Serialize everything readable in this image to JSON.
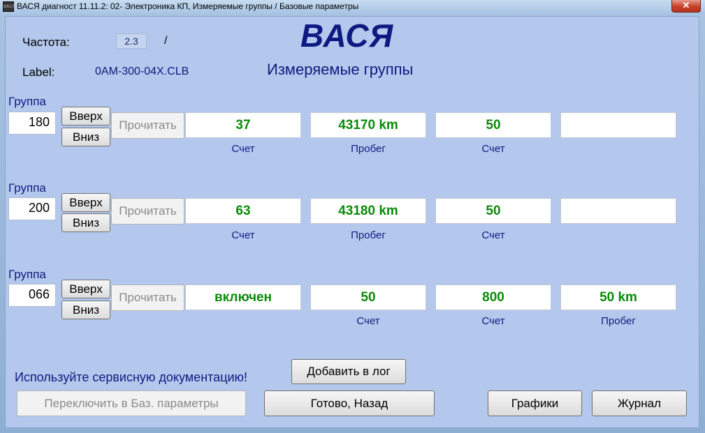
{
  "window": {
    "title": "ВАСЯ диагност 11.11.2: 02- Электроника КП,  Измеряемые группы / Базовые параметры",
    "icon": "app-icon",
    "icon_text": "ВАСЯ",
    "close_glyph": "✕"
  },
  "header": {
    "freq_label": "Частота:",
    "freq_value": "2.3",
    "freq_slash": "/",
    "label_label": "Label:",
    "label_value": "0AM-300-04X.CLB",
    "brand": "ВАСЯ",
    "subtitle": "Измеряемые группы"
  },
  "groups": [
    {
      "label": "Группа",
      "value": "180",
      "up": "Вверх",
      "down": "Вниз",
      "read": "Прочитать",
      "fields": [
        {
          "value": "37",
          "unit": "Счет"
        },
        {
          "value": "43170 km",
          "unit": "Пробег"
        },
        {
          "value": "50",
          "unit": "Счет"
        },
        {
          "value": "",
          "unit": ""
        }
      ]
    },
    {
      "label": "Группа",
      "value": "200",
      "up": "Вверх",
      "down": "Вниз",
      "read": "Прочитать",
      "fields": [
        {
          "value": "63",
          "unit": "Счет"
        },
        {
          "value": "43180 km",
          "unit": "Пробег"
        },
        {
          "value": "50",
          "unit": "Счет"
        },
        {
          "value": "",
          "unit": ""
        }
      ]
    },
    {
      "label": "Группа",
      "value": "066",
      "up": "Вверх",
      "down": "Вниз",
      "read": "Прочитать",
      "fields": [
        {
          "value": "включен",
          "unit": ""
        },
        {
          "value": "50",
          "unit": "Счет"
        },
        {
          "value": "800",
          "unit": "Счет"
        },
        {
          "value": "50 km",
          "unit": "Пробег"
        }
      ]
    }
  ],
  "footer": {
    "hint": "Используйте сервисную документацию!",
    "add_log": "Добавить в лог",
    "switch_basic": "Переключить в Баз. параметры",
    "done_back": "Готово, Назад",
    "graphs": "Графики",
    "journal": "Журнал"
  },
  "colors": {
    "value_green": "#0a8a0a",
    "label_blue": "#0d1a82",
    "client_bg": "#b3c8ec"
  }
}
